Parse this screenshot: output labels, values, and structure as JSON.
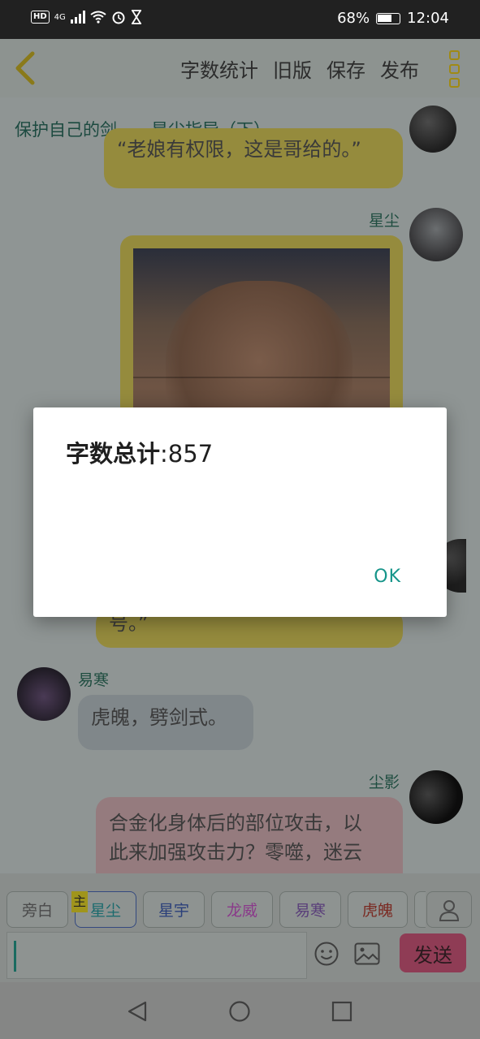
{
  "status_bar": {
    "network": "4G",
    "battery": "68%",
    "time": "12:04"
  },
  "header": {
    "actions": [
      "字数统计",
      "旧版",
      "保存",
      "发布"
    ]
  },
  "chapter_title": "保护自己的剑……星尘指导（下）",
  "messages": {
    "partial_top": "“老娘有权限，这是哥给的。”",
    "speaker_1": "星尘",
    "hidden_tail": "号。”",
    "speaker_2": "易寒",
    "bubble_2": "虎魄，劈剑式。",
    "speaker_3": "尘影",
    "bubble_3_line1": "合金化身体后的部位攻击，以",
    "bubble_3_line2": "此来加强攻击力？零噬，迷云"
  },
  "characters": {
    "main_tag": "主",
    "chips": [
      {
        "label": "旁白",
        "color": "#4a4a4a"
      },
      {
        "label": "星尘",
        "color": "#1c6b6e"
      },
      {
        "label": "星宇",
        "color": "#2a3f7a"
      },
      {
        "label": "龙威",
        "color": "#8a3a8a"
      },
      {
        "label": "易寒",
        "color": "#5a3f7a"
      },
      {
        "label": "虎魄",
        "color": "#7a2a22"
      }
    ]
  },
  "input": {
    "send_label": "发送"
  },
  "dialog": {
    "label": "字数总计",
    "value": ":857",
    "ok": "OK"
  }
}
